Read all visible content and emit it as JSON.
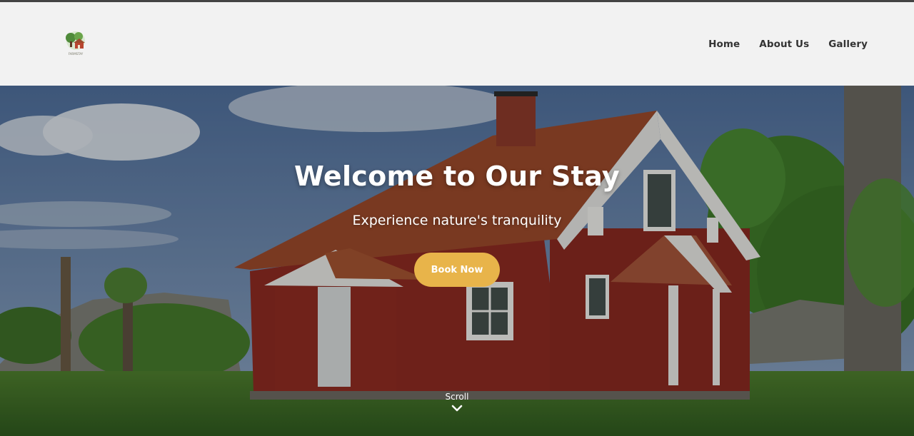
{
  "header": {
    "logo_text": "FARMSTAY",
    "nav": [
      {
        "label": "Home"
      },
      {
        "label": "About Us"
      },
      {
        "label": "Gallery"
      }
    ]
  },
  "hero": {
    "title": "Welcome to Our Stay",
    "subtitle": "Experience nature's tranquility",
    "button_label": "Book Now",
    "scroll_label": "Scroll",
    "scroll_icon": "chevron-down-icon"
  },
  "colors": {
    "accent": "#e8b44a",
    "house_red": "#8e2b22",
    "roof": "#9c4a2b",
    "header_bg": "#fafafa"
  }
}
